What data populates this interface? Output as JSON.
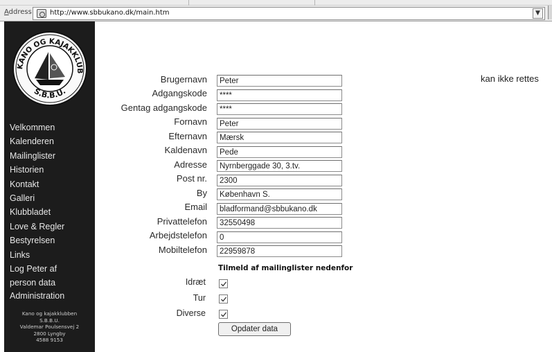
{
  "browser": {
    "address_label_prefix": "A",
    "address_label_rest": "ddress",
    "url": "http://www.sbbukano.dk/main.htm",
    "page_icon": "page-icon",
    "dropdown_icon": "chevron-down-icon"
  },
  "sidebar": {
    "logo_text": "KANO OG KAJAKKLUBBEN",
    "logo_subtext": "S.B.B.U.",
    "nav": [
      {
        "label": "Velkommen"
      },
      {
        "label": "Kalenderen"
      },
      {
        "label": "Mailinglister"
      },
      {
        "label": "Historien"
      },
      {
        "label": "Kontakt"
      },
      {
        "label": "Galleri"
      },
      {
        "label": "Klubbladet"
      },
      {
        "label": "Love & Regler"
      },
      {
        "label": "Bestyrelsen"
      },
      {
        "label": "Links"
      },
      {
        "label": "Log Peter af"
      },
      {
        "label": "person data"
      },
      {
        "label": "Administration"
      }
    ],
    "footer": [
      "Kano og kajakklubben",
      "S.B.B.U.",
      "Valdemar Poulsensvej 2",
      "2800 Lyngby",
      "4588 9153"
    ]
  },
  "form": {
    "fields": [
      {
        "label": "Brugernavn",
        "value": "Peter"
      },
      {
        "label": "Adgangskode",
        "value": "****"
      },
      {
        "label": "Gentag adgangskode",
        "value": "****"
      },
      {
        "label": "Fornavn",
        "value": "Peter"
      },
      {
        "label": "Efternavn",
        "value": "Mærsk"
      },
      {
        "label": "Kaldenavn",
        "value": "Pede"
      },
      {
        "label": "Adresse",
        "value": "Nyrnberggade 30, 3.tv."
      },
      {
        "label": "Post nr.",
        "value": "2300"
      },
      {
        "label": "By",
        "value": "København S."
      },
      {
        "label": "Email",
        "value": "bladformand@sbbukano.dk"
      },
      {
        "label": "Privattelefon",
        "value": "32550498"
      },
      {
        "label": "Arbejdstelefon",
        "value": "0"
      },
      {
        "label": "Mobiltelefon",
        "value": "22959878"
      }
    ],
    "username_note": "kan ikke rettes",
    "mailinglist_heading": "Tilmeld af mailinglister nedenfor",
    "mailinglists": [
      {
        "label": "Idræt",
        "checked": true
      },
      {
        "label": "Tur",
        "checked": true
      },
      {
        "label": "Diverse",
        "checked": true
      }
    ],
    "submit_label": "Opdater data"
  }
}
